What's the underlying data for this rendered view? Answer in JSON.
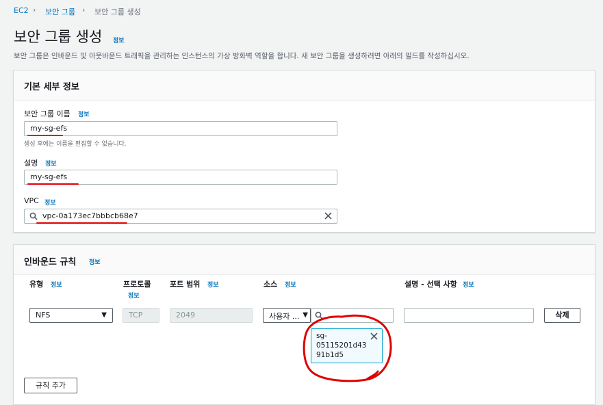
{
  "breadcrumb": {
    "root": "EC2",
    "section": "보안 그룹",
    "current": "보안 그룹 생성"
  },
  "page": {
    "title": "보안 그룹 생성",
    "info": "정보",
    "description": "보안 그룹은 인바운드 및 아웃바운드 트래픽을 관리하는 인스턴스의 가상 방화벽 역할을 합니다. 새 보안 그룹을 생성하려면 아래의 필드를 작성하십시오."
  },
  "basic": {
    "title": "기본 세부 정보",
    "name_label": "보안 그룹 이름",
    "name_info": "정보",
    "name_value": "my-sg-efs",
    "name_hint": "생성 후에는 이름을 편집할 수 없습니다.",
    "desc_label": "설명",
    "desc_info": "정보",
    "desc_value": "my-sg-efs",
    "vpc_label": "VPC",
    "vpc_info": "정보",
    "vpc_value": "vpc-0a173ec7bbbcb68e7"
  },
  "inbound": {
    "title": "인바운드 규칙",
    "info": "정보",
    "headers": {
      "type": "유형",
      "type_info": "정보",
      "protocol": "프로토콜",
      "protocol_info": "정보",
      "port": "포트 범위",
      "port_info": "정보",
      "source": "소스",
      "source_info": "정보",
      "desc": "설명 - 선택 사항",
      "desc_info": "정보"
    },
    "row": {
      "type": "NFS",
      "protocol": "TCP",
      "port": "2049",
      "source_select": "사용자 ...",
      "source_search": "",
      "token_line1": "sg-",
      "token_line2": "05115201d43",
      "token_line3": "91b1d5",
      "desc": "",
      "delete_label": "삭제"
    },
    "add_rule_label": "규칙 추가"
  },
  "colors": {
    "link": "#0073bb",
    "annotation": "#e00000",
    "token_border": "#00a1c9"
  }
}
